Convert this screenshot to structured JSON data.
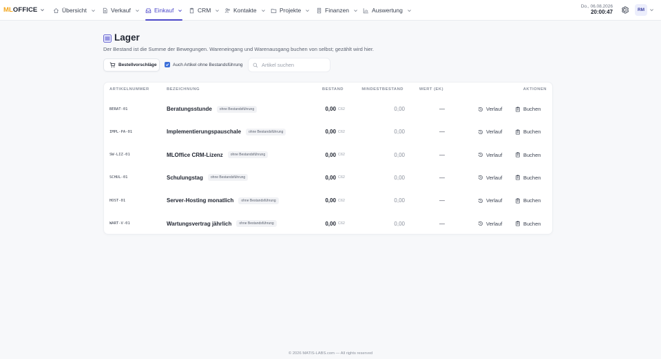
{
  "nav": {
    "logo_ml": "ML",
    "logo_office": "OFFICE",
    "items": [
      {
        "label": "Übersicht"
      },
      {
        "label": "Verkauf"
      },
      {
        "label": "Einkauf"
      },
      {
        "label": "CRM"
      },
      {
        "label": "Kontakte"
      },
      {
        "label": "Projekte"
      },
      {
        "label": "Finanzen"
      },
      {
        "label": "Auswertung"
      }
    ],
    "active": "Einkauf",
    "date": "Do., 06.08.2026",
    "time": "20:00:47",
    "avatar": "RM"
  },
  "page": {
    "title": "Lager",
    "subtitle": "Der Bestand ist die Summe der Bewegungen. Wareneingang und Warenausgang buchen von selbst; gezählt wird hier."
  },
  "toolbar": {
    "suggest_label": "Bestellvorschläge",
    "checkbox_label": "Auch Artikel ohne Bestandsführung",
    "checkbox_checked": true,
    "search_placeholder": "Artikel suchen"
  },
  "table": {
    "headers": {
      "nr": "ARTIKELNUMMER",
      "name": "BEZEICHNUNG",
      "stock": "BESTAND",
      "min": "MINDESTBESTAND",
      "value": "WERT (EK)",
      "actions": "AKTIONEN"
    },
    "rows": [
      {
        "nr": "BERAT-01",
        "name": "Beratungsstunde",
        "badge": "ohne Bestandsführung",
        "stock": "0,00",
        "unit": "C62",
        "min": "0,00",
        "value": "—",
        "history": "Verlauf",
        "book": "Buchen"
      },
      {
        "nr": "IMPL-PA-01",
        "name": "Implementierungspauschale",
        "badge": "ohne Bestandsführung",
        "stock": "0,00",
        "unit": "C62",
        "min": "0,00",
        "value": "—",
        "history": "Verlauf",
        "book": "Buchen"
      },
      {
        "nr": "SW-LIZ-01",
        "name": "MLOffice CRM-Lizenz",
        "badge": "ohne Bestandsführung",
        "stock": "0,00",
        "unit": "C62",
        "min": "0,00",
        "value": "—",
        "history": "Verlauf",
        "book": "Buchen"
      },
      {
        "nr": "SCHUL-01",
        "name": "Schulungstag",
        "badge": "ohne Bestandsführung",
        "stock": "0,00",
        "unit": "C62",
        "min": "0,00",
        "value": "—",
        "history": "Verlauf",
        "book": "Buchen"
      },
      {
        "nr": "HOST-01",
        "name": "Server-Hosting monatlich",
        "badge": "ohne Bestandsführung",
        "stock": "0,00",
        "unit": "C62",
        "min": "0,00",
        "value": "—",
        "history": "Verlauf",
        "book": "Buchen"
      },
      {
        "nr": "WART-V-01",
        "name": "Wartungsvertrag jährlich",
        "badge": "ohne Bestandsführung",
        "stock": "0,00",
        "unit": "C62",
        "min": "0,00",
        "value": "—",
        "history": "Verlauf",
        "book": "Buchen"
      }
    ]
  },
  "footer": "© 2026 MATIS-LABS.com — All rights reserved",
  "colors": {
    "accent": "#4a46c8",
    "logo_orange": "#f2a51a",
    "checkbox": "#3b6fd9",
    "background": "#f7f8fa"
  },
  "icons": {
    "home": "home-icon",
    "sales": "document-icon",
    "purchase": "inbox-icon",
    "crm": "clipboard-icon",
    "contacts": "users-icon",
    "projects": "folder-icon",
    "finance": "building-icon",
    "reports": "chart-icon",
    "settings": "gear-icon",
    "warehouse": "warehouse-icon",
    "cart": "cart-icon",
    "search": "search-icon",
    "history": "history-icon",
    "book": "clipboard-icon"
  }
}
